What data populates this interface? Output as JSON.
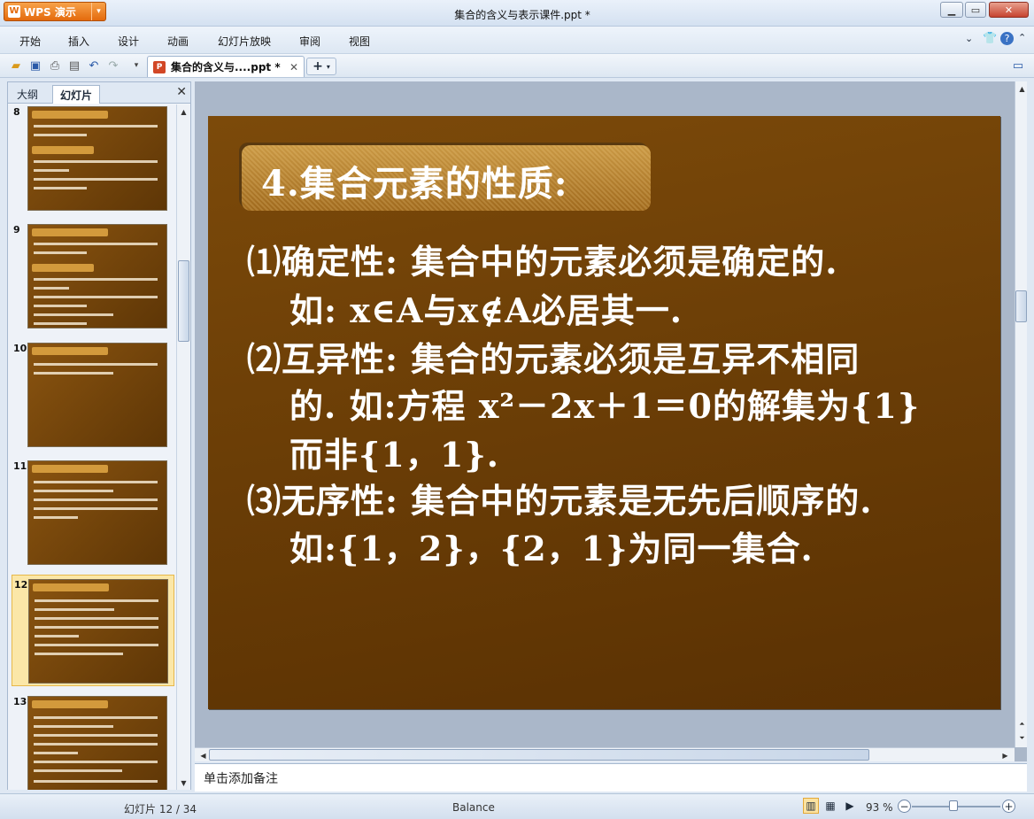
{
  "app": {
    "name": "WPS 演示",
    "window_title": "集合的含义与表示课件.ppt *"
  },
  "menu": [
    "开始",
    "插入",
    "设计",
    "动画",
    "幻灯片放映",
    "审阅",
    "视图"
  ],
  "toolbar": {
    "tab_label": "集合的含义与....ppt *"
  },
  "side_panel": {
    "tabs": [
      "大纲",
      "幻灯片"
    ],
    "active_tab": "幻灯片",
    "slide_numbers": [
      "8",
      "9",
      "10",
      "11",
      "12",
      "13"
    ],
    "selected": "12"
  },
  "slide": {
    "title": "4.集合元素的性质:",
    "lines": [
      "⑴确定性: 集合中的元素必须是确定的.",
      "如: x∈A与x∉A必居其一.",
      "⑵互异性: 集合的元素必须是互异不相同",
      "的.  如:方程 x²－2x＋1＝0的解集为{1}",
      "而非{1，1}.",
      "⑶无序性: 集合中的元素是无先后顺序的.",
      "如:{1，2}，{2，1}为同一集合."
    ]
  },
  "notes_placeholder": "单击添加备注",
  "status": {
    "slide_counter": "幻灯片 12 / 34",
    "theme": "Balance",
    "zoom": "93 %"
  }
}
